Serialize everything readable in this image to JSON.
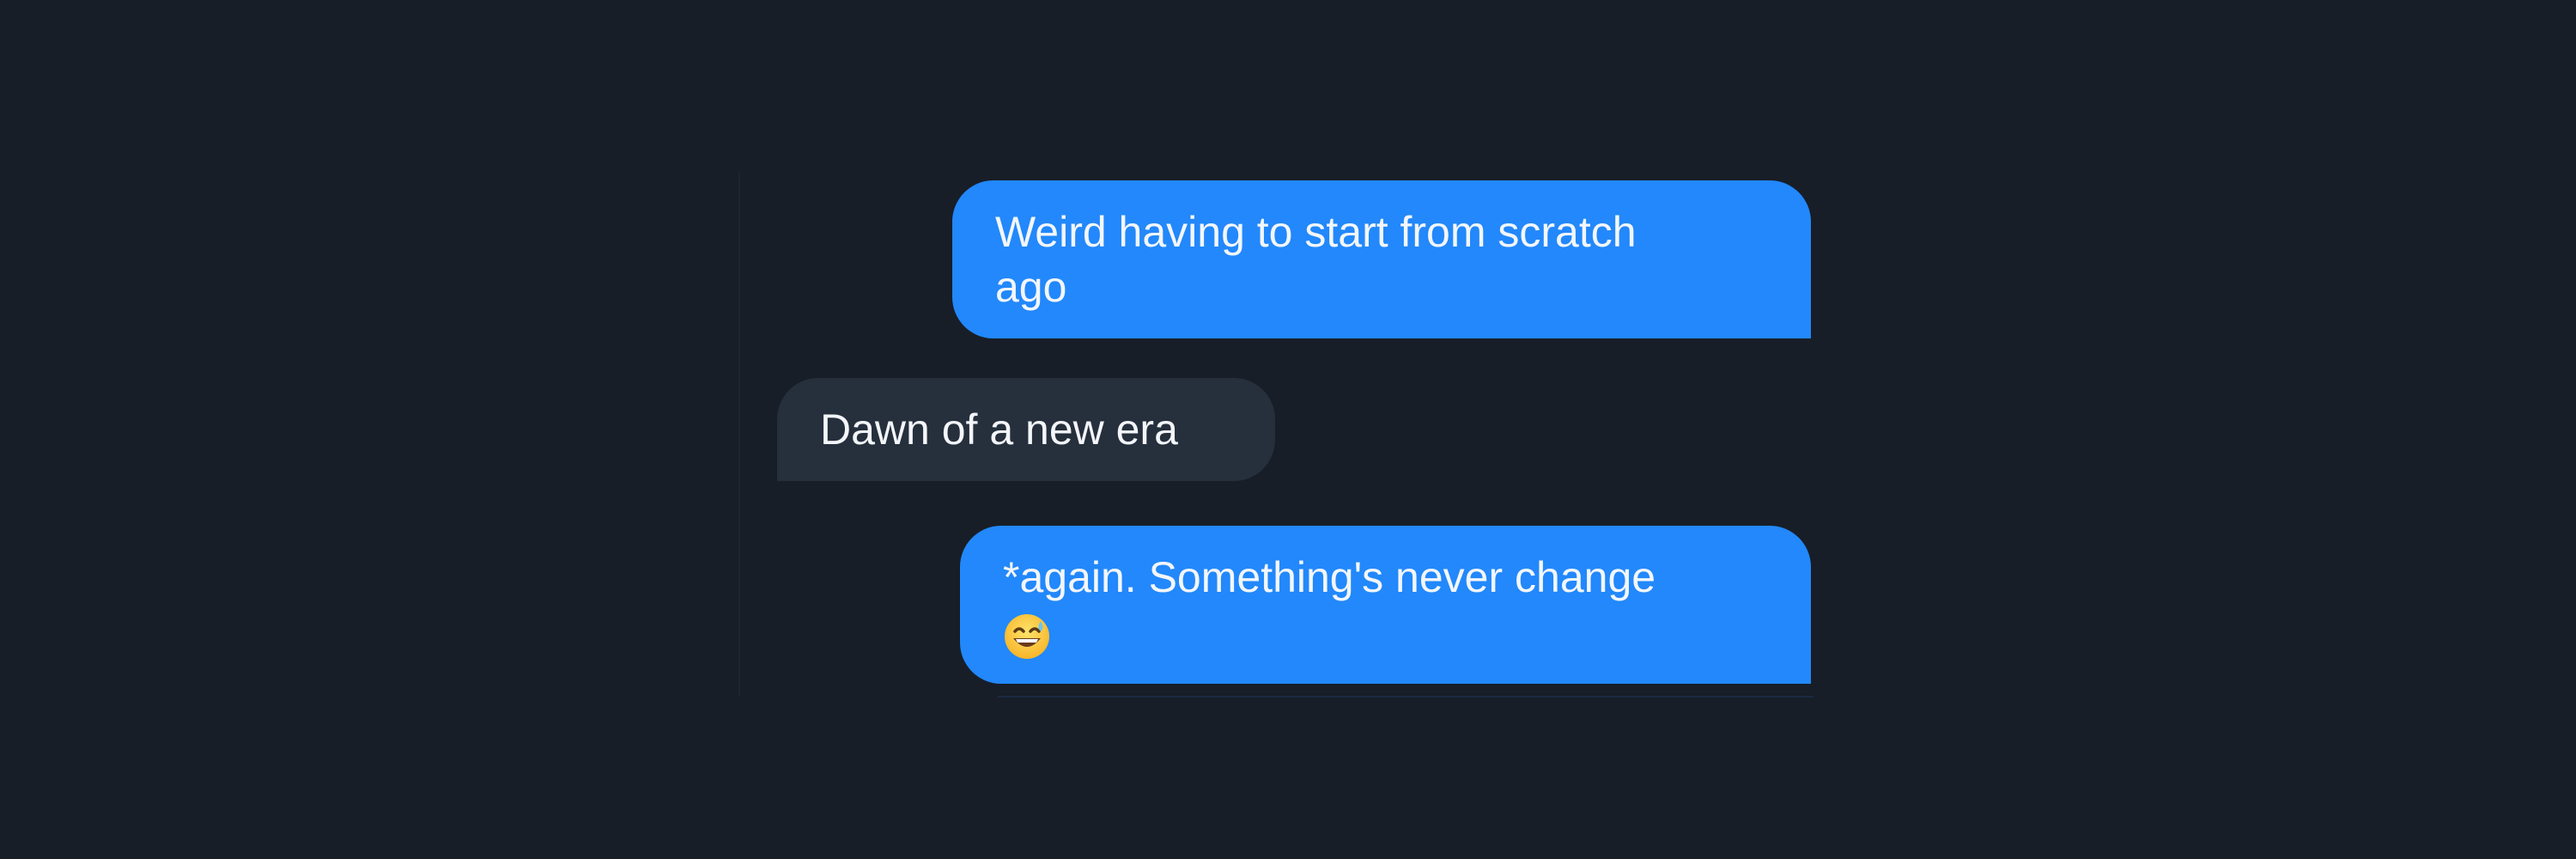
{
  "messages": [
    {
      "direction": "outgoing",
      "lines": [
        "Weird having to start from scratch",
        "ago"
      ]
    },
    {
      "direction": "incoming",
      "lines": [
        "Dawn of a new era"
      ]
    },
    {
      "direction": "outgoing",
      "lines": [
        "*again. Something's never change"
      ],
      "emoji": "grinning-face-with-sweat-icon"
    }
  ],
  "colors": {
    "background": "#171e28",
    "outgoing_bubble": "#2288fb",
    "incoming_bubble": "#262f3c",
    "text": "#f3f6fa"
  }
}
